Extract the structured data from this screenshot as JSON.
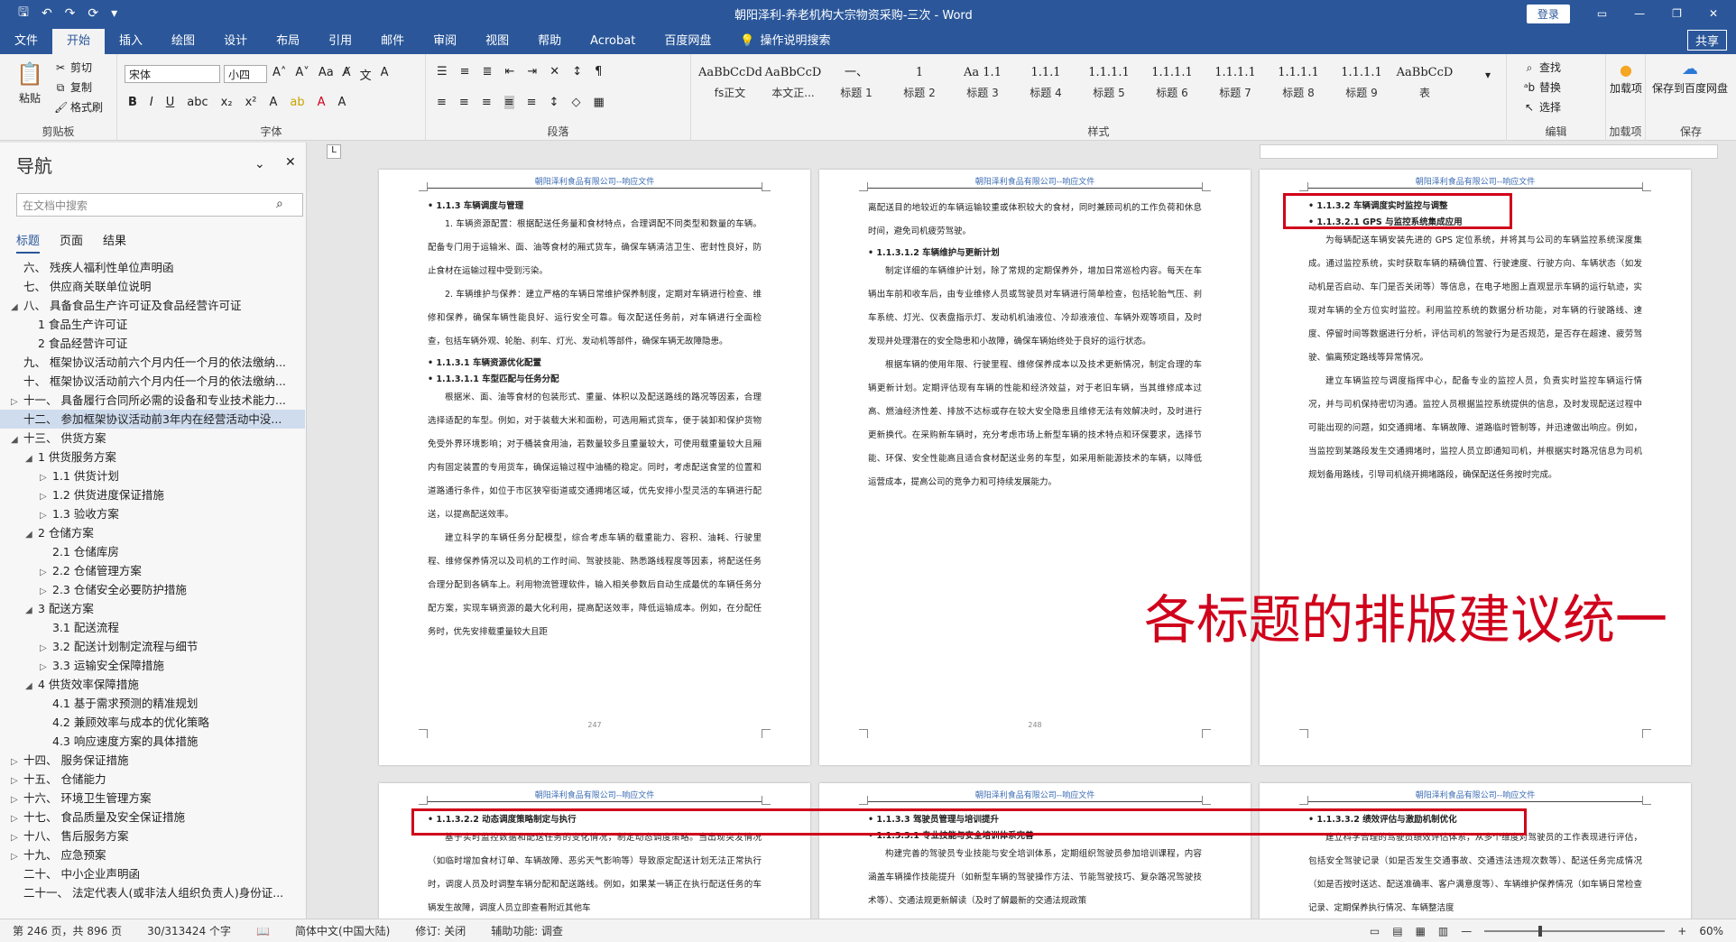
{
  "titlebar": {
    "title": "朝阳泽利-养老机构大宗物资采购-三次  -  Word",
    "login": "登录",
    "icons": [
      "save-icon",
      "undo-icon",
      "redo-icon",
      "autosave-icon",
      "customize-icon"
    ]
  },
  "tabs": [
    "文件",
    "开始",
    "插入",
    "绘图",
    "设计",
    "布局",
    "引用",
    "邮件",
    "审阅",
    "视图",
    "帮助",
    "Acrobat",
    "百度网盘"
  ],
  "active_tab": "开始",
  "tell_me": "操作说明搜索",
  "share": "共享",
  "clipboard": {
    "paste": "粘贴",
    "cut": "剪切",
    "copy": "复制",
    "format_painter": "格式刷",
    "label": "剪贴板"
  },
  "font": {
    "name": "宋体",
    "size": "小四",
    "label": "字体"
  },
  "paragraph": {
    "label": "段落"
  },
  "styles": {
    "label": "样式",
    "items": [
      {
        "sample": "AaBbCcDdI",
        "name": "fs正文"
      },
      {
        "sample": "AaBbCcD",
        "name": "本文正..."
      },
      {
        "sample": "一、",
        "name": "标题 1"
      },
      {
        "sample": "1",
        "name": "标题 2"
      },
      {
        "sample": "Aa 1.1",
        "name": "标题 3"
      },
      {
        "sample": "1.1.1",
        "name": "标题 4"
      },
      {
        "sample": "1.1.1.1",
        "name": "标题 5"
      },
      {
        "sample": "1.1.1.1",
        "name": "标题 6"
      },
      {
        "sample": "1.1.1.1",
        "name": "标题 7"
      },
      {
        "sample": "1.1.1.1",
        "name": "标题 8"
      },
      {
        "sample": "1.1.1.1",
        "name": "标题 9"
      },
      {
        "sample": "AaBbCcD",
        "name": "表"
      }
    ]
  },
  "editing": {
    "find": "查找",
    "replace": "替换",
    "select": "选择",
    "label": "编辑"
  },
  "addins": {
    "name": "加载项",
    "label": "加载项"
  },
  "save": {
    "name": "保存到百度网盘",
    "label": "保存"
  },
  "nav": {
    "title": "导航",
    "search_placeholder": "在文档中搜索",
    "tabs": [
      "标题",
      "页面",
      "结果"
    ],
    "items": [
      {
        "text": "六、 残疾人福利性单位声明函",
        "indent": 1,
        "tri": ""
      },
      {
        "text": "七、 供应商关联单位说明",
        "indent": 1,
        "tri": ""
      },
      {
        "text": "八、 具备食品生产许可证及食品经营许可证",
        "indent": 1,
        "tri": "◢"
      },
      {
        "text": "1 食品生产许可证",
        "indent": 2,
        "tri": ""
      },
      {
        "text": "2 食品经营许可证",
        "indent": 2,
        "tri": ""
      },
      {
        "text": "九、 框架协议活动前六个月内任一个月的依法缴纳...",
        "indent": 1,
        "tri": ""
      },
      {
        "text": "十、 框架协议活动前六个月内任一个月的依法缴纳...",
        "indent": 1,
        "tri": ""
      },
      {
        "text": "十一、 具备履行合同所必需的设备和专业技术能力...",
        "indent": 1,
        "tri": "▷"
      },
      {
        "text": "十二、 参加框架协议活动前3年内在经营活动中没...",
        "indent": 1,
        "tri": "",
        "sel": true
      },
      {
        "text": "十三、 供货方案",
        "indent": 1,
        "tri": "◢"
      },
      {
        "text": "1 供货服务方案",
        "indent": 2,
        "tri": "◢"
      },
      {
        "text": "1.1 供货计划",
        "indent": 3,
        "tri": "▷"
      },
      {
        "text": "1.2 供货进度保证措施",
        "indent": 3,
        "tri": "▷"
      },
      {
        "text": "1.3 验收方案",
        "indent": 3,
        "tri": "▷"
      },
      {
        "text": "2 仓储方案",
        "indent": 2,
        "tri": "◢"
      },
      {
        "text": "2.1 仓储库房",
        "indent": 3,
        "tri": ""
      },
      {
        "text": "2.2 仓储管理方案",
        "indent": 3,
        "tri": "▷"
      },
      {
        "text": "2.3 仓储安全必要防护措施",
        "indent": 3,
        "tri": "▷"
      },
      {
        "text": "3 配送方案",
        "indent": 2,
        "tri": "◢"
      },
      {
        "text": "3.1 配送流程",
        "indent": 3,
        "tri": ""
      },
      {
        "text": "3.2 配送计划制定流程与细节",
        "indent": 3,
        "tri": "▷"
      },
      {
        "text": "3.3 运输安全保障措施",
        "indent": 3,
        "tri": "▷"
      },
      {
        "text": "4 供货效率保障措施",
        "indent": 2,
        "tri": "◢"
      },
      {
        "text": "4.1 基于需求预测的精准规划",
        "indent": 3,
        "tri": ""
      },
      {
        "text": "4.2 兼顾效率与成本的优化策略",
        "indent": 3,
        "tri": ""
      },
      {
        "text": "4.3 响应速度方案的具体措施",
        "indent": 3,
        "tri": ""
      },
      {
        "text": "十四、 服务保证措施",
        "indent": 1,
        "tri": "▷"
      },
      {
        "text": "十五、 仓储能力",
        "indent": 1,
        "tri": "▷"
      },
      {
        "text": "十六、 环境卫生管理方案",
        "indent": 1,
        "tri": "▷"
      },
      {
        "text": "十七、 食品质量及安全保证措施",
        "indent": 1,
        "tri": "▷"
      },
      {
        "text": "十八、 售后服务方案",
        "indent": 1,
        "tri": "▷"
      },
      {
        "text": "十九、 应急预案",
        "indent": 1,
        "tri": "▷"
      },
      {
        "text": "二十、 中小企业声明函",
        "indent": 1,
        "tri": ""
      },
      {
        "text": "二十一、 法定代表人(或非法人组织负责人)身份证...",
        "indent": 1,
        "tri": ""
      }
    ]
  },
  "pages": {
    "header": "朝阳泽利食品有限公司--响应文件",
    "p1": {
      "footer": "247",
      "blocks": [
        {
          "t": "h",
          "text": "• 1.1.3 车辆调度与管理"
        },
        {
          "t": "p",
          "text": "1. 车辆资源配置：根据配送任务量和食材特点，合理调配不同类型和数量的车辆。配备专门用于运输米、面、油等食材的厢式货车，确保车辆清洁卫生、密封性良好，防止食材在运输过程中受到污染。"
        },
        {
          "t": "p",
          "text": "2. 车辆维护与保养：建立严格的车辆日常维护保养制度，定期对车辆进行检查、维修和保养，确保车辆性能良好、运行安全可靠。每次配送任务前，对车辆进行全面检查，包括车辆外观、轮胎、刹车、灯光、发动机等部件，确保车辆无故障隐患。"
        },
        {
          "t": "h",
          "text": "• 1.1.3.1 车辆资源优化配置"
        },
        {
          "t": "h",
          "text": "• 1.1.3.1.1 车型匹配与任务分配"
        },
        {
          "t": "p",
          "text": "根据米、面、油等食材的包装形式、重量、体积以及配送路线的路况等因素，合理选择适配的车型。例如，对于装载大米和面粉，可选用厢式货车，便于装卸和保护货物免受外界环境影响；对于桶装食用油，若数量较多且重量较大，可使用载重量较大且厢内有固定装置的专用货车，确保运输过程中油桶的稳定。同时，考虑配送食堂的位置和道路通行条件，如位于市区狭窄街道或交通拥堵区域，优先安排小型灵活的车辆进行配送，以提高配送效率。"
        },
        {
          "t": "p",
          "text": "建立科学的车辆任务分配模型，综合考虑车辆的载重能力、容积、油耗、行驶里程、维修保养情况以及司机的工作时间、驾驶技能、熟悉路线程度等因素，将配送任务合理分配到各辆车上。利用物流管理软件，输入相关参数后自动生成最优的车辆任务分配方案，实现车辆资源的最大化利用，提高配送效率，降低运输成本。例如，在分配任务时，优先安排载重量较大且距"
        }
      ]
    },
    "p2": {
      "footer": "248",
      "blocks": [
        {
          "t": "p0",
          "text": "离配送目的地较近的车辆运输较重或体积较大的食材，同时兼顾司机的工作负荷和休息时间，避免司机疲劳驾驶。"
        },
        {
          "t": "h",
          "text": "• 1.1.3.1.2 车辆维护与更新计划"
        },
        {
          "t": "p",
          "text": "制定详细的车辆维护计划，除了常规的定期保养外，增加日常巡检内容。每天在车辆出车前和收车后，由专业维修人员或驾驶员对车辆进行简单检查，包括轮胎气压、刹车系统、灯光、仪表盘指示灯、发动机机油液位、冷却液液位、车辆外观等项目，及时发现并处理潜在的安全隐患和小故障，确保车辆始终处于良好的运行状态。"
        },
        {
          "t": "p",
          "text": "根据车辆的使用年限、行驶里程、维修保养成本以及技术更新情况，制定合理的车辆更新计划。定期评估现有车辆的性能和经济效益，对于老旧车辆，当其维修成本过高、燃油经济性差、排放不达标或存在较大安全隐患且维修无法有效解决时，及时进行更新换代。在采购新车辆时，充分考虑市场上新型车辆的技术特点和环保要求，选择节能、环保、安全性能高且适合食材配送业务的车型，如采用新能源技术的车辆，以降低运营成本，提高公司的竞争力和可持续发展能力。"
        }
      ]
    },
    "p3": {
      "footer": "",
      "blocks": [
        {
          "t": "h",
          "text": "• 1.1.3.2 车辆调度实时监控与调整"
        },
        {
          "t": "h",
          "text": "• 1.1.3.2.1 GPS 与监控系统集成应用"
        },
        {
          "t": "p",
          "text": "为每辆配送车辆安装先进的 GPS 定位系统，并将其与公司的车辆监控系统深度集成。通过监控系统，实时获取车辆的精确位置、行驶速度、行驶方向、车辆状态（如发动机是否启动、车门是否关闭等）等信息，在电子地图上直观显示车辆的运行轨迹，实现对车辆的全方位实时监控。利用监控系统的数据分析功能，对车辆的行驶路线、速度、停留时间等数据进行分析，评估司机的驾驶行为是否规范，是否存在超速、疲劳驾驶、偏离预定路线等异常情况。"
        },
        {
          "t": "p",
          "text": "建立车辆监控与调度指挥中心，配备专业的监控人员，负责实时监控车辆运行情况，并与司机保持密切沟通。监控人员根据监控系统提供的信息，及时发现配送过程中可能出现的问题，如交通拥堵、车辆故障、道路临时管制等，并迅速做出响应。例如，当监控到某路段发生交通拥堵时，监控人员立即通知司机，并根据实时路况信息为司机规划备用路线，引导司机绕开拥堵路段，确保配送任务按时完成。"
        }
      ]
    },
    "p4": {
      "blocks": [
        {
          "t": "h",
          "text": "• 1.1.3.2.2 动态调度策略制定与执行"
        },
        {
          "t": "p",
          "text": "基于实时监控数据和配送任务的变化情况，制定动态调度策略。当出现突发情况（如临时增加食材订单、车辆故障、恶劣天气影响等）导致原定配送计划无法正常执行时，调度人员及时调整车辆分配和配送路线。例如，如果某一辆正在执行配送任务的车辆发生故障，调度人员立即查看附近其他车"
        }
      ]
    },
    "p5": {
      "blocks": [
        {
          "t": "h",
          "text": "• 1.1.3.3 驾驶员管理与培训提升"
        },
        {
          "t": "h",
          "text": "• 1.1.3.3.1 专业技能与安全培训体系完善"
        },
        {
          "t": "p",
          "text": "构建完善的驾驶员专业技能与安全培训体系，定期组织驾驶员参加培训课程，内容涵盖车辆操作技能提升（如新型车辆的驾驶操作方法、节能驾驶技巧、复杂路况驾驶技术等）、交通法规更新解读（及时了解最新的交通法规政策"
        }
      ]
    },
    "p6": {
      "blocks": [
        {
          "t": "h",
          "text": "• 1.1.3.3.2 绩效评估与激励机制优化"
        },
        {
          "t": "p",
          "text": "建立科学合理的驾驶员绩效评估体系，从多个维度对驾驶员的工作表现进行评估，包括安全驾驶记录（如是否发生交通事故、交通违法违规次数等）、配送任务完成情况（如是否按时送达、配送准确率、客户满意度等）、车辆维护保养情况（如车辆日常检查记录、定期保养执行情况、车辆整洁度"
        }
      ]
    }
  },
  "annotation": "各标题的排版建议统一",
  "statusbar": {
    "page": "第 246 页，共 896 页",
    "words": "30/313424 个字",
    "lang": "简体中文(中国大陆)",
    "revision": "修订: 关闭",
    "accessibility": "辅助功能: 调查",
    "zoom": "60%"
  }
}
